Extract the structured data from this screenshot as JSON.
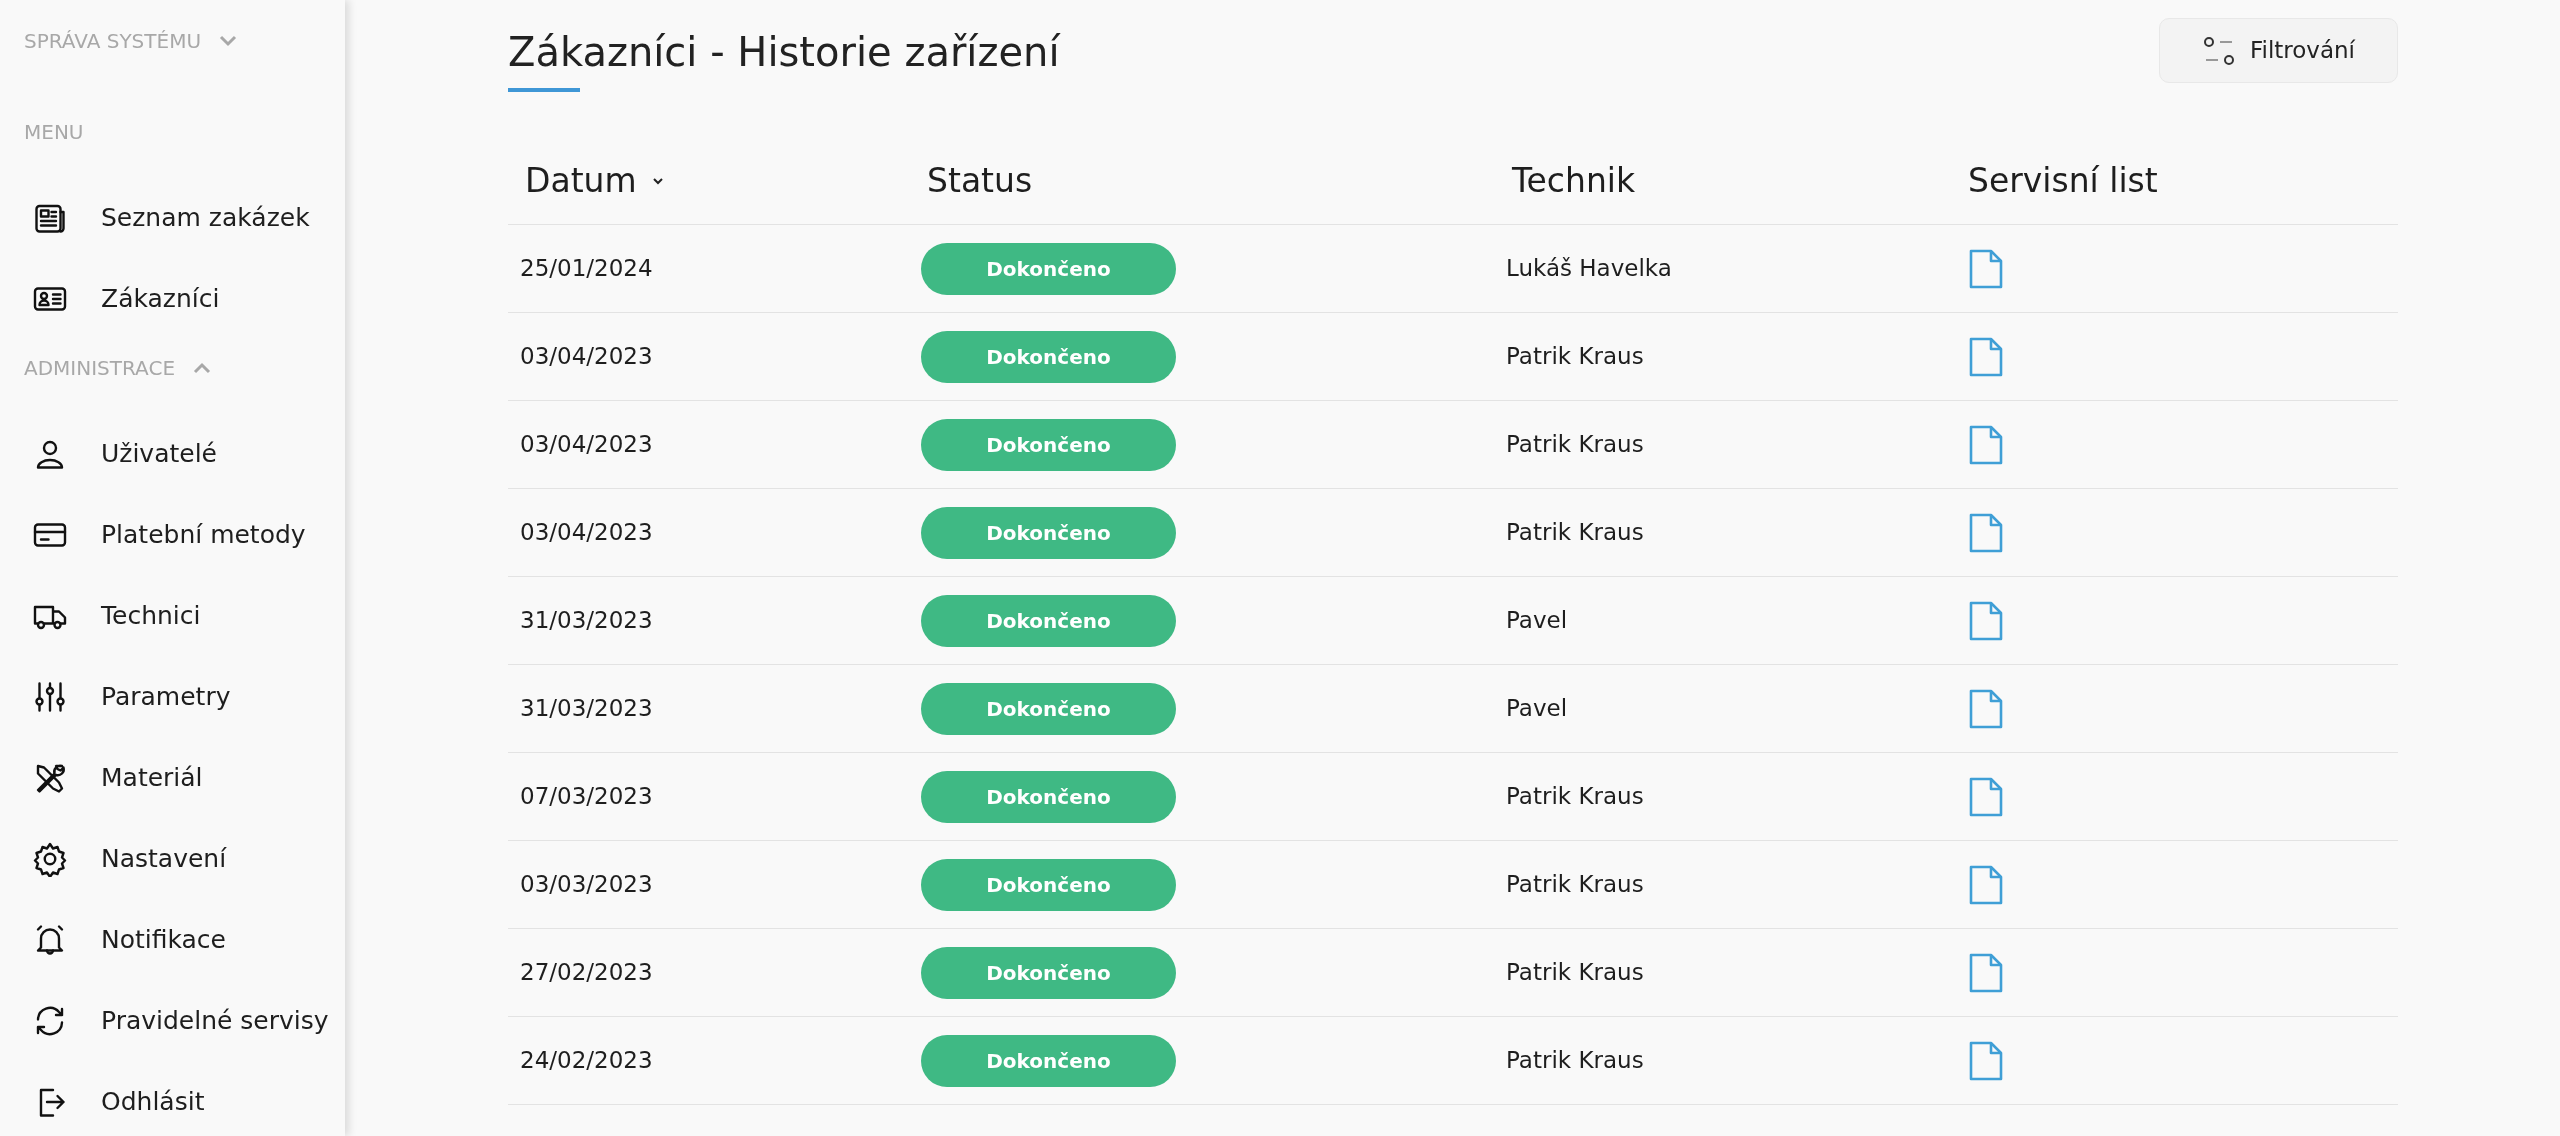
{
  "sidebar": {
    "sections": [
      {
        "label": "SPRÁVA SYSTÉMU",
        "kind": "group",
        "expanded": false
      },
      {
        "label": "MENU",
        "kind": "heading",
        "items": [
          "Seznam zakázek",
          "Zákazníci"
        ]
      },
      {
        "label": "ADMINISTRACE",
        "kind": "group",
        "expanded": true,
        "items": [
          "Uživatelé",
          "Platební metody",
          "Technici",
          "Parametry",
          "Materiál",
          "Nastavení",
          "Notifikace",
          "Pravidelné servisy",
          "Odhlásit"
        ]
      }
    ]
  },
  "page": {
    "title": "Zákazníci - Historie zařízení",
    "filter_button": "Filtrování"
  },
  "table": {
    "columns": [
      {
        "label": "Datum",
        "sorted": true
      },
      {
        "label": "Status",
        "sorted": false
      },
      {
        "label": "Technik",
        "sorted": false
      },
      {
        "label": "Servisní list",
        "sorted": false
      }
    ],
    "rows": [
      {
        "date": "25/01/2024",
        "status": "Dokončeno",
        "technician": "Lukáš Havelka"
      },
      {
        "date": "03/04/2023",
        "status": "Dokončeno",
        "technician": "Patrik Kraus"
      },
      {
        "date": "03/04/2023",
        "status": "Dokončeno",
        "technician": "Patrik Kraus"
      },
      {
        "date": "03/04/2023",
        "status": "Dokončeno",
        "technician": "Patrik Kraus"
      },
      {
        "date": "31/03/2023",
        "status": "Dokončeno",
        "technician": "Pavel"
      },
      {
        "date": "31/03/2023",
        "status": "Dokončeno",
        "technician": "Pavel"
      },
      {
        "date": "07/03/2023",
        "status": "Dokončeno",
        "technician": "Patrik Kraus"
      },
      {
        "date": "03/03/2023",
        "status": "Dokončeno",
        "technician": "Patrik Kraus"
      },
      {
        "date": "27/02/2023",
        "status": "Dokončeno",
        "technician": "Patrik Kraus"
      },
      {
        "date": "24/02/2023",
        "status": "Dokončeno",
        "technician": "Patrik Kraus"
      }
    ]
  }
}
